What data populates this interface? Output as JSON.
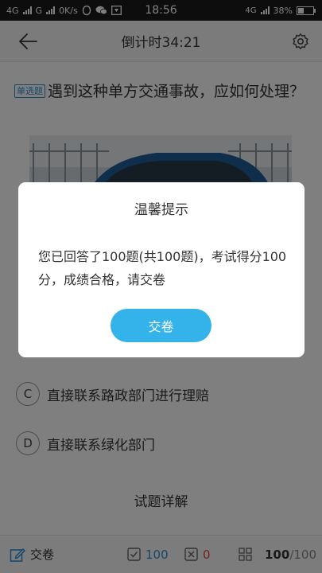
{
  "status_bar": {
    "network1": "4G",
    "network2": "G",
    "speed": "0K/s",
    "time": "18:56",
    "network3": "4G",
    "battery": "38%"
  },
  "header": {
    "title": "倒计时34:21"
  },
  "question": {
    "type_badge": "单选题",
    "text": "遇到这种单方交通事故，应如何处理？"
  },
  "options": [
    {
      "letter": "C",
      "text": "直接联系路政部门进行理赔"
    },
    {
      "letter": "D",
      "text": "直接联系绿化部门"
    }
  ],
  "detail": {
    "title": "试题详解"
  },
  "bottom_bar": {
    "submit_label": "交卷",
    "correct_count": "100",
    "wrong_count": "0",
    "progress_done": "100",
    "progress_total": "/100"
  },
  "dialog": {
    "title": "温馨提示",
    "message": "您已回答了100题(共100题)，考试得分100分，成绩合格，请交卷",
    "button_label": "交卷"
  },
  "colors": {
    "accent": "#33b3e9",
    "correct": "#2b8fd6",
    "wrong": "#e04a3f"
  }
}
